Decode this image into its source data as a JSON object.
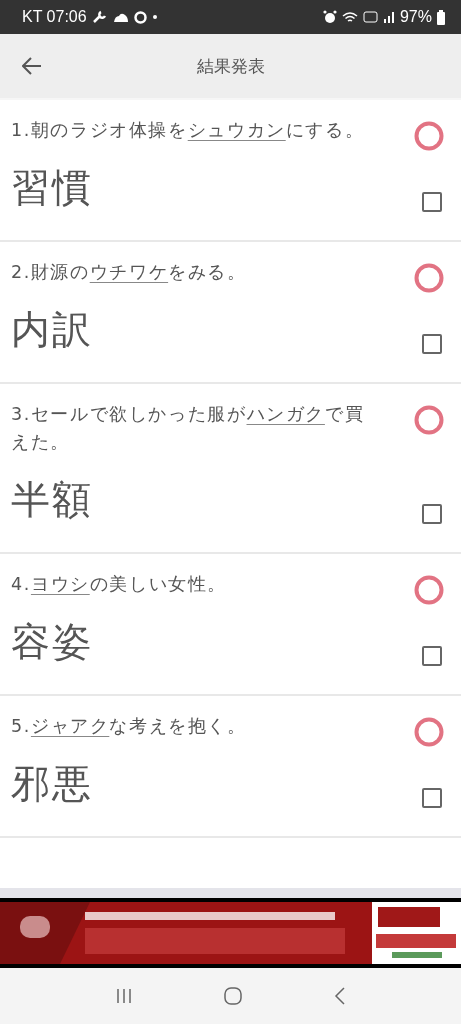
{
  "status_bar": {
    "carrier_time": "KT 07:06",
    "battery": "97%"
  },
  "header": {
    "title": "結果発表"
  },
  "items": [
    {
      "number": "1.",
      "before": "朝のラジオ体操を",
      "underlined": "シュウカン",
      "after": "にする。",
      "answer": "習慣",
      "correct": true,
      "checked": false
    },
    {
      "number": "2.",
      "before": "財源の",
      "underlined": "ウチワケ",
      "after": "をみる。",
      "answer": "内訳",
      "correct": true,
      "checked": false
    },
    {
      "number": "3.",
      "before": "セールで欲しかった服が",
      "underlined": "ハンガク",
      "after": "で買えた。",
      "answer": "半額",
      "correct": true,
      "checked": false
    },
    {
      "number": "4.",
      "underlined": "ヨウシ",
      "after": "の美しい女性。",
      "answer": "容姿",
      "correct": true,
      "checked": false
    },
    {
      "number": "5.",
      "underlined": "ジャアク",
      "after": "な考えを抱く。",
      "answer": "邪悪",
      "correct": true,
      "checked": false
    }
  ]
}
